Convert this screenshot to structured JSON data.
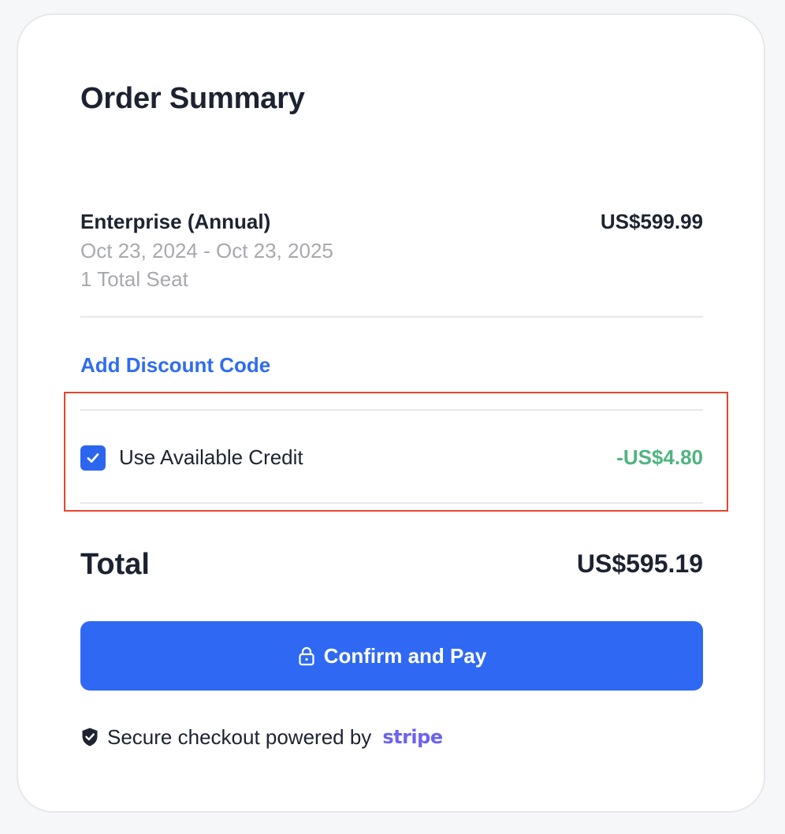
{
  "summary": {
    "title": "Order Summary",
    "item": {
      "name": "Enterprise (Annual)",
      "price": "US$599.99",
      "dates": "Oct 23, 2024 - Oct 23, 2025",
      "seats": "1 Total Seat"
    },
    "discount_link": "Add Discount Code",
    "credit": {
      "label": "Use Available Credit",
      "amount": "-US$4.80",
      "checked": true
    },
    "total": {
      "label": "Total",
      "value": "US$595.19"
    },
    "pay_button": {
      "label": "Confirm and Pay",
      "icon": "lock-icon"
    },
    "secure_note": {
      "text": "Secure checkout powered by",
      "brand": "stripe",
      "icon": "shield-check-icon"
    }
  },
  "colors": {
    "accent": "#2f69f3",
    "link": "#2f6cf0",
    "credit_green": "#4fb480",
    "highlight_border": "#e4452c",
    "stripe_purple": "#6b63f2"
  }
}
